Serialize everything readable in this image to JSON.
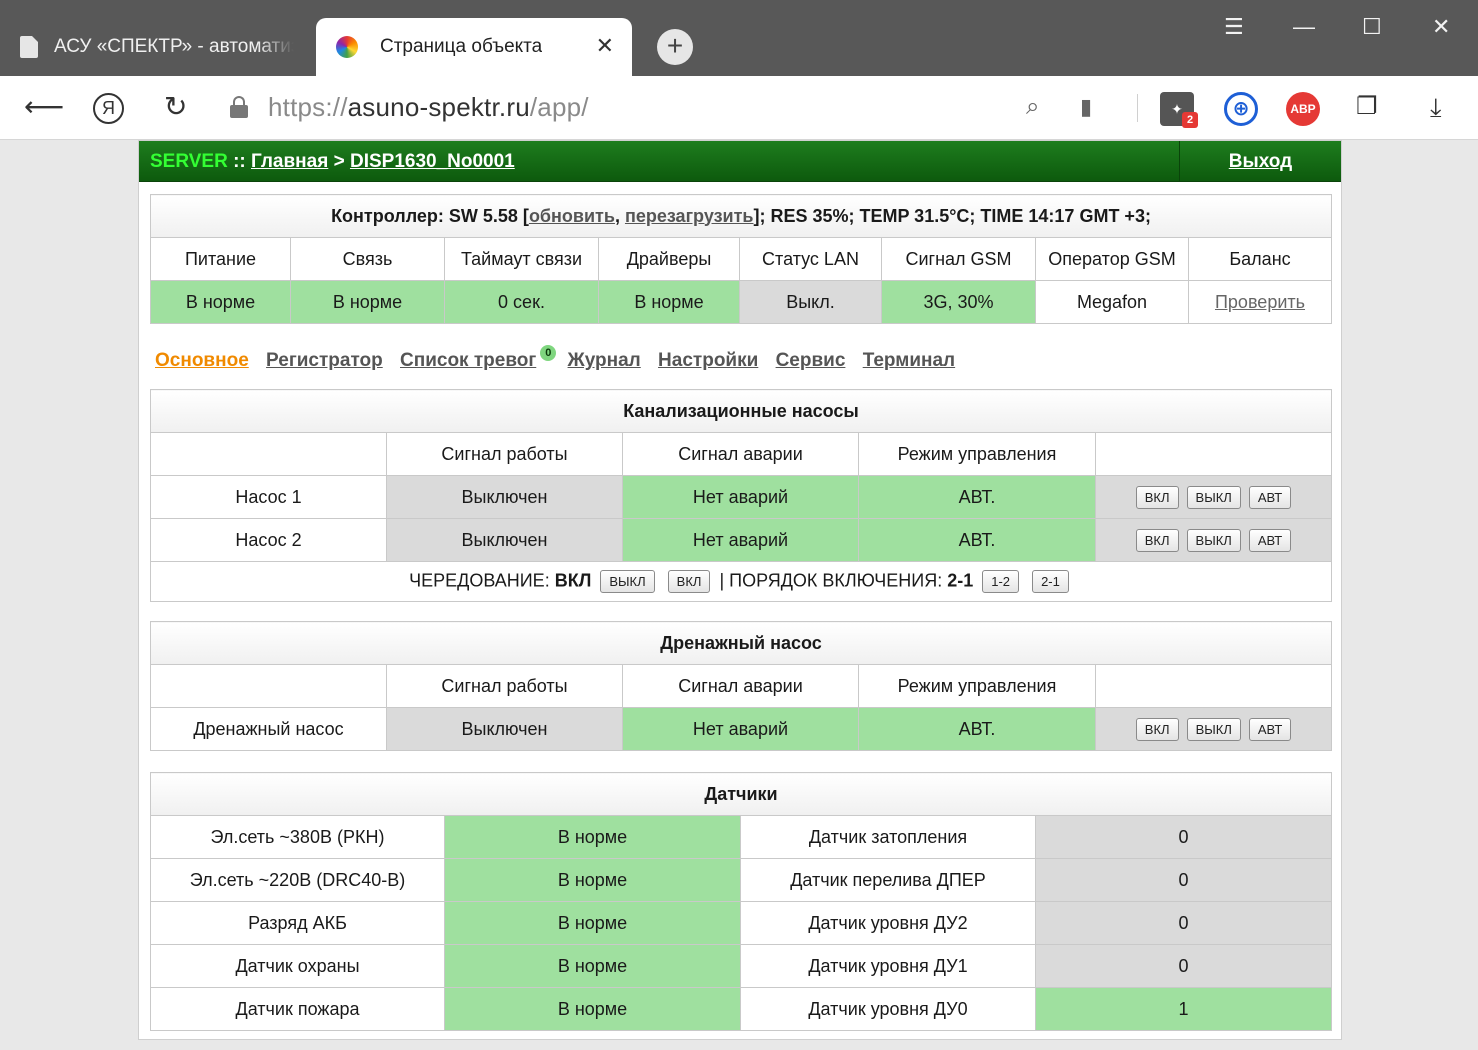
{
  "browser": {
    "tabs": [
      {
        "title": "АСУ «СПЕКТР» - автоматизация"
      },
      {
        "title": "Страница объекта"
      }
    ],
    "url_scheme": "https://",
    "url_host": "asuno-spektr.ru",
    "url_path": "/app/",
    "window_buttons": {
      "menu": "☰",
      "minimize": "—",
      "maximize": "☐",
      "close": "✕"
    },
    "ext_abp": "ABP",
    "ext_badge": "2"
  },
  "header": {
    "server": "SERVER",
    "sep": "::",
    "home": "Главная",
    "arrow": ">",
    "device": "DISP1630_No0001",
    "logout": "Выход"
  },
  "controller": {
    "prefix": "Контроллер: SW 5.58 [",
    "update": "обновить",
    "comma": ", ",
    "reboot": "перезагрузить",
    "suffix": "]; RES 35%; TEMP 31.5°C; TIME 14:17 GMT +3;",
    "columns": [
      "Питание",
      "Связь",
      "Таймаут связи",
      "Драйверы",
      "Статус LAN",
      "Сигнал GSM",
      "Оператор GSM",
      "Баланс"
    ],
    "values": [
      "В норме",
      "В норме",
      "0 сек.",
      "В норме",
      "Выкл.",
      "3G, 30%",
      "Megafon",
      "Проверить"
    ]
  },
  "menu": {
    "items": [
      "Основное",
      "Регистратор",
      "Список тревог",
      "Журнал",
      "Настройки",
      "Сервис",
      "Терминал"
    ],
    "alarm_count": "0"
  },
  "sewage": {
    "title": "Канализационные насосы",
    "columns": [
      "Сигнал работы",
      "Сигнал аварии",
      "Режим управления"
    ],
    "rows": [
      {
        "name": "Насос 1",
        "work": "Выключен",
        "alarm": "Нет аварий",
        "mode": "АВТ."
      },
      {
        "name": "Насос 2",
        "work": "Выключен",
        "alarm": "Нет аварий",
        "mode": "АВТ."
      }
    ],
    "buttons": {
      "on": "ВКЛ",
      "off": "ВЫКЛ",
      "auto": "АВТ"
    },
    "alternation_label": "ЧЕРЕДОВАНИЕ:",
    "alternation_value": "ВКЛ",
    "alt_btn_off": "ВЫКЛ",
    "alt_btn_on": "ВКЛ",
    "order_label": "| ПОРЯДОК ВКЛЮЧЕНИЯ:",
    "order_value": "2-1",
    "order_btn_1": "1-2",
    "order_btn_2": "2-1"
  },
  "drain": {
    "title": "Дренажный насос",
    "columns": [
      "Сигнал работы",
      "Сигнал аварии",
      "Режим управления"
    ],
    "row": {
      "name": "Дренажный насос",
      "work": "Выключен",
      "alarm": "Нет аварий",
      "mode": "АВТ."
    }
  },
  "sensors": {
    "title": "Датчики",
    "rows": [
      {
        "left": "Эл.сеть ~380В (РКН)",
        "left_val": "В норме",
        "right": "Датчик затопления",
        "right_val": "0",
        "right_ok": false
      },
      {
        "left": "Эл.сеть ~220В (DRC40-B)",
        "left_val": "В норме",
        "right": "Датчик перелива ДПЕР",
        "right_val": "0",
        "right_ok": false
      },
      {
        "left": "Разряд АКБ",
        "left_val": "В норме",
        "right": "Датчик уровня ДУ2",
        "right_val": "0",
        "right_ok": false
      },
      {
        "left": "Датчик охраны",
        "left_val": "В норме",
        "right": "Датчик уровня ДУ1",
        "right_val": "0",
        "right_ok": false
      },
      {
        "left": "Датчик пожара",
        "left_val": "В норме",
        "right": "Датчик уровня ДУ0",
        "right_val": "1",
        "right_ok": true
      }
    ]
  },
  "colors": {
    "ok_green": "#9fe09f",
    "neutral_gray": "#dadada",
    "header_green": "#1e7d1e",
    "server_green": "#33ff33",
    "active_menu": "#f08a00"
  }
}
